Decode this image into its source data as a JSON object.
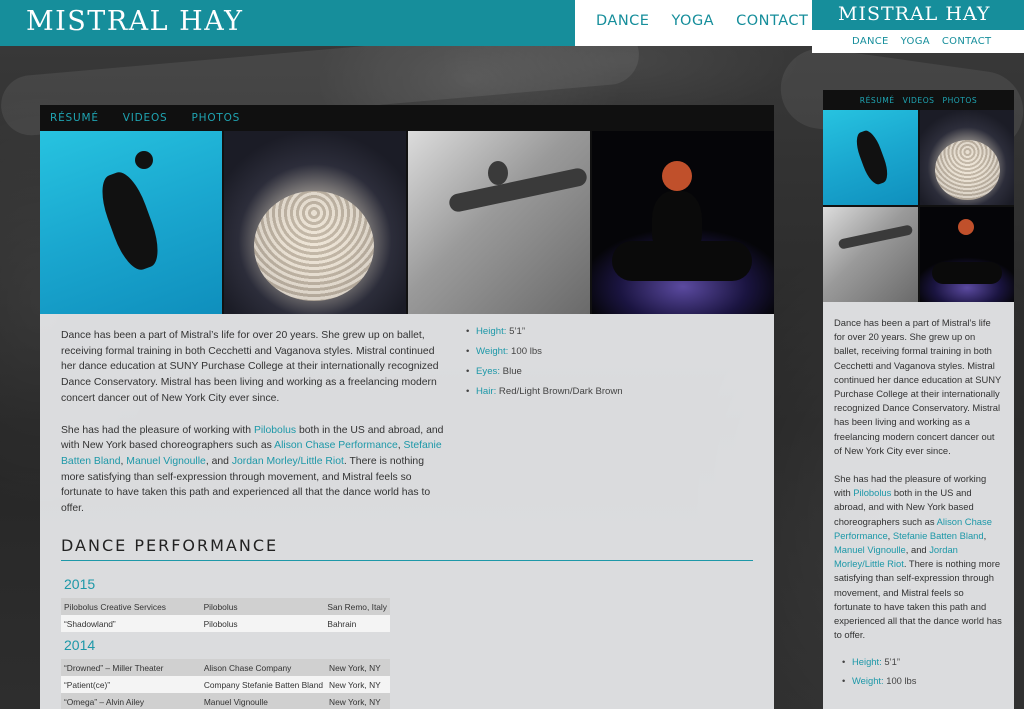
{
  "site": {
    "brand": "Mistral Hay"
  },
  "topnav": {
    "dance": "DANCE",
    "yoga": "YOGA",
    "contact": "CONTACT"
  },
  "mobile_nav": {
    "dance": "DANCE",
    "yoga": "YOGA",
    "contact": "CONTACT"
  },
  "subnav": {
    "resume": "Résumé",
    "videos": "Videos",
    "photos": "Photos"
  },
  "bio": {
    "p1_lead": "Dance",
    "p1_rest": " has been a part of Mistral’s life for over 20 years. She grew up on ballet, receiving formal training in both Cecchetti and Vaganova styles. Mistral continued her dance education at SUNY Purchase College at their internationally recognized Dance Conservatory. Mistral has been living and working as a freelancing modern concert dancer out of New York City ever since.",
    "p2_a": "She has had the pleasure of working with ",
    "link_pilobolus": "Pilobolus",
    "p2_b": " both in the US and abroad, and with New York based choreographers such as ",
    "link_alison": "Alison Chase Performance",
    "p2_c": ", ",
    "link_stefanie": "Stefanie Batten Bland",
    "p2_d": ", ",
    "link_manuel": "Manuel Vignoulle",
    "p2_e": ", and ",
    "link_jordan": "Jordan Morley/Little Riot",
    "p2_f": ". There is nothing more satisfying than self-expression through movement, and Mistral feels so fortunate to have taken this path and experienced all that the dance world has to offer."
  },
  "stats": [
    {
      "key": "Height:",
      "value": " 5’1”"
    },
    {
      "key": "Weight:",
      "value": " 100 lbs"
    },
    {
      "key": "Eyes:",
      "value": " Blue"
    },
    {
      "key": "Hair:",
      "value": " Red/Light Brown/Dark Brown"
    }
  ],
  "section": {
    "title": "DANCE PERFORMANCE"
  },
  "performances": [
    {
      "year": "2015",
      "rows": [
        [
          "Pilobolus Creative Services",
          "Pilobolus",
          "San Remo, Italy"
        ],
        [
          "“Shadowland”",
          "Pilobolus",
          "Bahrain"
        ]
      ]
    },
    {
      "year": "2014",
      "rows": [
        [
          "“Drowned” – Miller Theater",
          "Alison Chase Company",
          "New York, NY"
        ],
        [
          "“Patient(ce)”",
          "Company Stefanie Batten Bland",
          "New York, NY"
        ],
        [
          "“Omega” – Alvin Ailey",
          "Manuel Vignoulle",
          "New York, NY"
        ]
      ]
    }
  ],
  "colors": {
    "accent": "#168e9b",
    "link": "#1d98a8",
    "subnav_bg": "#101010"
  },
  "icons": {
    "bullet": "bullet-dot"
  }
}
